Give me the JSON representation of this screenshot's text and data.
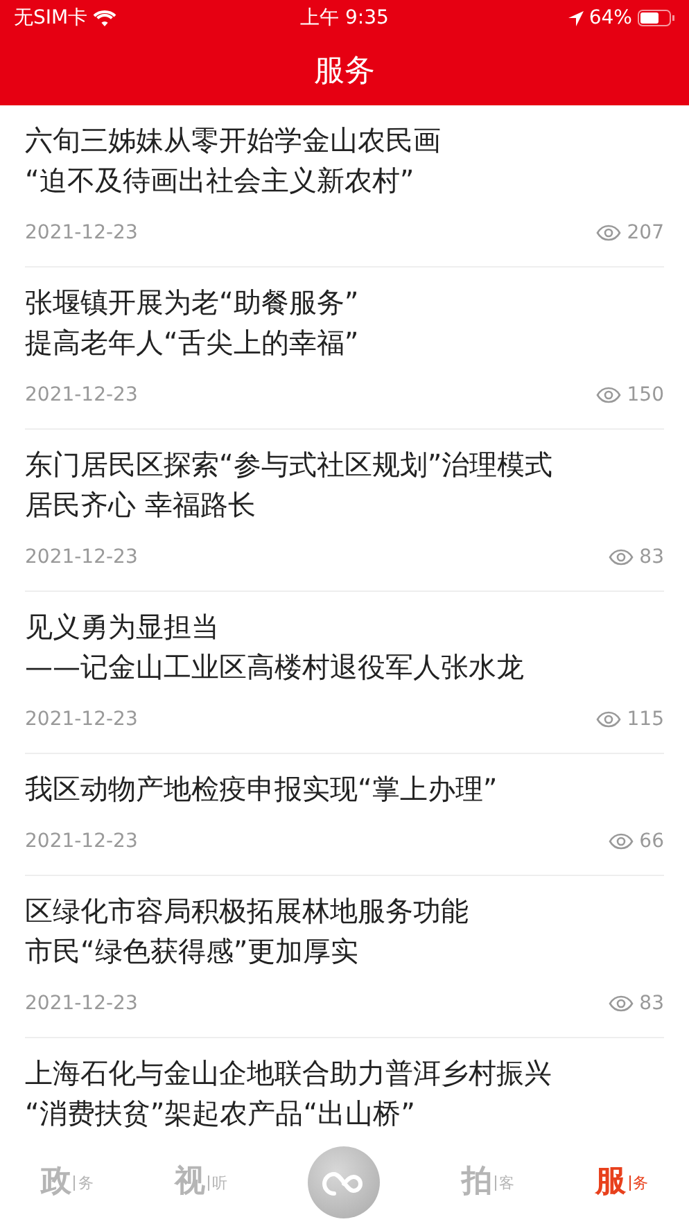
{
  "status_bar": {
    "carrier": "无SIM卡",
    "time": "上午 9:35",
    "battery": "64%"
  },
  "header": {
    "title": "服务"
  },
  "articles": [
    {
      "title_lines": [
        "六旬三姊妹从零开始学金山农民画",
        "“迫不及待画出社会主义新农村”"
      ],
      "date": "2021-12-23",
      "views": "207"
    },
    {
      "title_lines": [
        "张堰镇开展为老“助餐服务”",
        "提高老年人“舌尖上的幸福”"
      ],
      "date": "2021-12-23",
      "views": "150"
    },
    {
      "title_lines": [
        "东门居民区探索“参与式社区规划”治理模式",
        "居民齐心 幸福路长"
      ],
      "date": "2021-12-23",
      "views": "83"
    },
    {
      "title_lines": [
        "见义勇为显担当",
        "——记金山工业区高楼村退役军人张水龙"
      ],
      "date": "2021-12-23",
      "views": "115"
    },
    {
      "title_lines": [
        "我区动物产地检疫申报实现“掌上办理”"
      ],
      "date": "2021-12-23",
      "views": "66"
    },
    {
      "title_lines": [
        "区绿化市容局积极拓展林地服务功能",
        "市民“绿色获得感”更加厚实"
      ],
      "date": "2021-12-23",
      "views": "83"
    },
    {
      "title_lines": [
        "上海石化与金山企地联合助力普洱乡村振兴",
        "“消费扶贫”架起农产品“出山桥”"
      ]
    }
  ],
  "tab_bar": [
    {
      "kind": "tab",
      "big": "政",
      "small": "务",
      "selected": false
    },
    {
      "kind": "tab",
      "big": "视",
      "small": "听",
      "selected": false
    },
    {
      "kind": "center"
    },
    {
      "kind": "tab",
      "big": "拍",
      "small": "客",
      "selected": false
    },
    {
      "kind": "tab",
      "big": "服",
      "small": "务",
      "selected": true
    }
  ]
}
